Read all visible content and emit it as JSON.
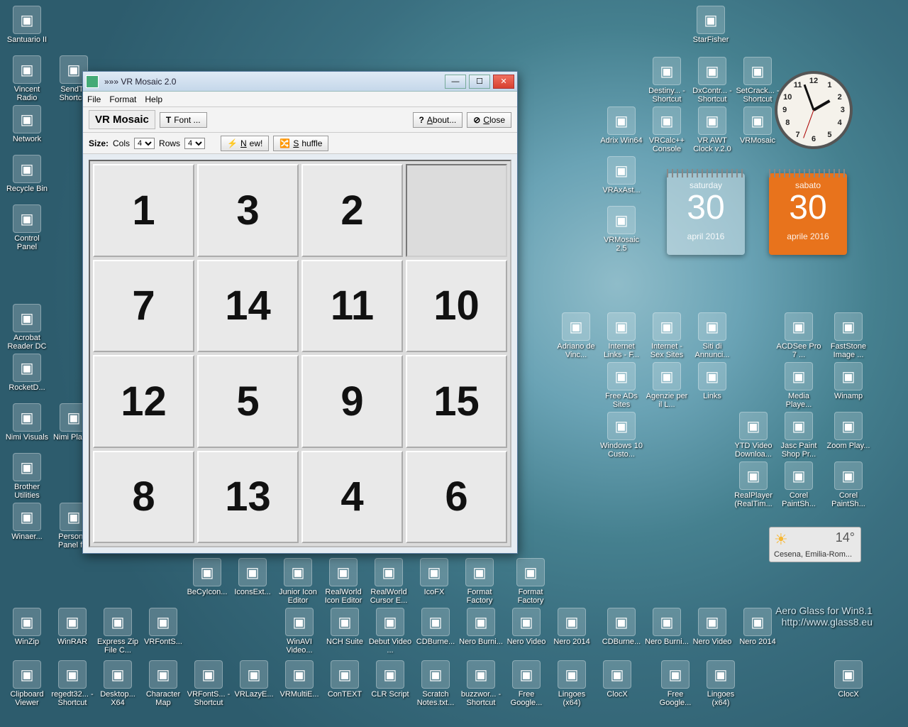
{
  "window": {
    "title": "»»» VR Mosaic 2.0",
    "menu": {
      "file": "File",
      "format": "Format",
      "help": "Help"
    },
    "app_title": "VR Mosaic",
    "font_btn": "Font ...",
    "about_btn": "About...",
    "close_btn": "Close",
    "size_label": "Size:",
    "cols_label": "Cols",
    "rows_label": "Rows",
    "cols_value": "4",
    "rows_value": "4",
    "new_btn": "New!",
    "shuffle_btn": "Shuffle",
    "tiles": [
      "1",
      "3",
      "2",
      "",
      "7",
      "14",
      "11",
      "10",
      "12",
      "5",
      "9",
      "15",
      "8",
      "13",
      "4",
      "6"
    ]
  },
  "clock": {
    "h12": "12",
    "h1": "1",
    "h2": "2",
    "h3": "3",
    "h4": "4",
    "h5": "5",
    "h6": "6",
    "h7": "7",
    "h8": "8",
    "h9": "9",
    "h10": "10",
    "h11": "11"
  },
  "cal1": {
    "dow": "saturday",
    "day": "30",
    "my": "april 2016"
  },
  "cal2": {
    "dow": "sabato",
    "day": "30",
    "my": "aprile 2016"
  },
  "weather": {
    "temp": "14°",
    "loc": "Cesena, Emilia-Rom..."
  },
  "watermark": {
    "l1": "Aero Glass for Win8.1",
    "l2": "http://www.glass8.eu"
  },
  "icons": {
    "c0": [
      "Santuario II",
      "Vincent Radio",
      "Network",
      "Recycle Bin",
      "Control Panel",
      "",
      "Acrobat Reader DC",
      "RocketD...",
      "Nimi Visuals",
      "Brother Utilities",
      "Winaer..."
    ],
    "c1": [
      "",
      "SendTo Shortcut",
      "",
      "",
      "",
      "",
      "",
      "",
      "Nimi Places",
      "",
      "Personal Panel for"
    ],
    "c9": [
      "StarFisher",
      "Destiny... - Shortcut",
      "Adrix Win64",
      "VRAxAst...",
      "VRMosaic 2.5"
    ],
    "c10": [
      "",
      "DxContr... - Shortcut",
      "VRCalc++ Console"
    ],
    "c11": [
      "",
      "SetCrack... - Shortcut",
      "VR AWT Clock v.2.0"
    ],
    "c12": [
      "",
      "",
      "VRMosaic"
    ],
    "mid": [
      "Adriano de Vinc...",
      "Internet Links - F...",
      "Internet - Sex Sites",
      "Siti di Annunci...",
      "Free ADs Sites",
      "Agenzie per il L...",
      "Links",
      "Windows 10 Custo..."
    ],
    "r17": [
      "ACDSee Pro 7 ...",
      "FastStone Image ...",
      "Media Playe...",
      "Winamp",
      "YTD Video Downloa...",
      "Jasc Paint Shop Pr...",
      "Zoom Play...",
      "RealPlayer (RealTim...",
      "Corel PaintSh...",
      "Corel PaintSh..."
    ],
    "row_a": [
      "BeCyIcon...",
      "IconsExt...",
      "Junior Icon Editor",
      "RealWorld Icon Editor",
      "RealWorld Cursor E...",
      "IcoFX",
      "Format Factory"
    ],
    "row_b": [
      "WinZip",
      "WinRAR",
      "Express Zip File C...",
      "VRFontS...",
      "",
      "",
      "WinAVI Video...",
      "NCH Suite",
      "Debut Video ...",
      "CDBurne...",
      "Nero Burni...",
      "Nero Video",
      "Nero 2014"
    ],
    "row_c": [
      "Clipboard Viewer",
      "regedt32... - Shortcut",
      "Desktop... X64",
      "Character Map",
      "VRFontS... - Shortcut",
      "VRLazyE...",
      "VRMultiE...",
      "ConTEXT",
      "CLR Script",
      "Scratch Notes.txt...",
      "buzzwor... - Shortcut",
      "Free Google...",
      "Lingoes (x64)",
      "ClocX"
    ]
  }
}
